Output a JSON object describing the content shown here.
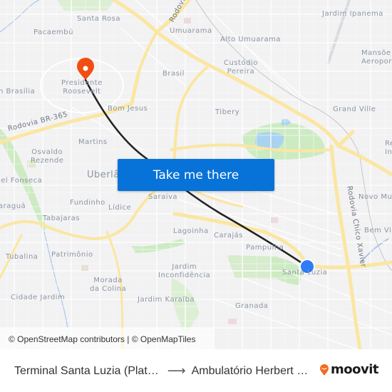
{
  "map": {
    "neighborhoods": [
      {
        "id": "santa-rosa",
        "label": "Santa Rosa"
      },
      {
        "id": "pacaembu",
        "label": "Pacaembú"
      },
      {
        "id": "umuarama",
        "label": "Umuarama"
      },
      {
        "id": "alto-umuarama",
        "label": "Alto Umuarama"
      },
      {
        "id": "jardim-ipanema",
        "label": "Jardim Ipanema"
      },
      {
        "id": "mansoes-aeroporto",
        "label": "Mansõe\nAeropor"
      },
      {
        "id": "presidente-roosevelt",
        "label": "Presidente\nRoosevelt"
      },
      {
        "id": "brasilia",
        "label": "n Brasília"
      },
      {
        "id": "brasil",
        "label": "Brasil"
      },
      {
        "id": "custodio-pereira",
        "label": "Custódio\nPereira"
      },
      {
        "id": "bom-jesus",
        "label": "Bom Jesus"
      },
      {
        "id": "tibery",
        "label": "Tibery"
      },
      {
        "id": "grand-ville",
        "label": "Grand Ville"
      },
      {
        "id": "martins",
        "label": "Martins"
      },
      {
        "id": "osvaldo-rezende",
        "label": "Osvaldo\nRezende"
      },
      {
        "id": "uberlandia",
        "label": "Uberlâ"
      },
      {
        "id": "daniel-fonseca",
        "label": "iel Fonseca"
      },
      {
        "id": "jaragua",
        "label": "araguá"
      },
      {
        "id": "fundinho",
        "label": "Fundinho"
      },
      {
        "id": "lidice",
        "label": "Lídice"
      },
      {
        "id": "saraiva",
        "label": "Saraiva"
      },
      {
        "id": "tabajaras",
        "label": "Tabajaras"
      },
      {
        "id": "lagoinha",
        "label": "Lagoinha"
      },
      {
        "id": "carajas",
        "label": "Carajás"
      },
      {
        "id": "pampulha",
        "label": "Pampulha"
      },
      {
        "id": "tubalina",
        "label": "Tubalina"
      },
      {
        "id": "patrimonio",
        "label": "Patrimônio"
      },
      {
        "id": "jardim-inconfidencia",
        "label": "Jardim\nInconfidência"
      },
      {
        "id": "santa-luzia",
        "label": "Santa Luzia"
      },
      {
        "id": "morada-da-colina",
        "label": "Morada\nda Colina"
      },
      {
        "id": "cidade-jardim",
        "label": "Cidade Jardim"
      },
      {
        "id": "jardim-karaiba",
        "label": "Jardim Karaíba"
      },
      {
        "id": "granada",
        "label": "Granada"
      },
      {
        "id": "novo-mundo",
        "label": "Novo Mu"
      },
      {
        "id": "bem-viver",
        "label": "Bem Viv"
      },
      {
        "id": "res-integracao",
        "label": "Re\nIn"
      }
    ],
    "roads": [
      {
        "id": "br-365",
        "label": "Rodovia BR-365"
      },
      {
        "id": "chico-xavier",
        "label": "Rodovia Chico Xavier"
      },
      {
        "id": "rodovia-top",
        "label": "Rodovi"
      }
    ],
    "destination_marker": {
      "icon": "map-pin-icon",
      "color": "#f24d12"
    },
    "origin_marker": {
      "icon": "origin-dot-icon",
      "color": "#2e7cf6"
    },
    "route_color": "#222222",
    "attribution": "© OpenStreetMap contributors | © OpenMapTiles"
  },
  "cta": {
    "label": "Take me there",
    "color": "#0772d8"
  },
  "footer": {
    "origin": "Terminal Santa Luzia (Plat…",
    "arrow": "⟶",
    "destination": "Ambulatório Herbert …",
    "brand": "moovit",
    "brand_color": "#f26c21"
  }
}
